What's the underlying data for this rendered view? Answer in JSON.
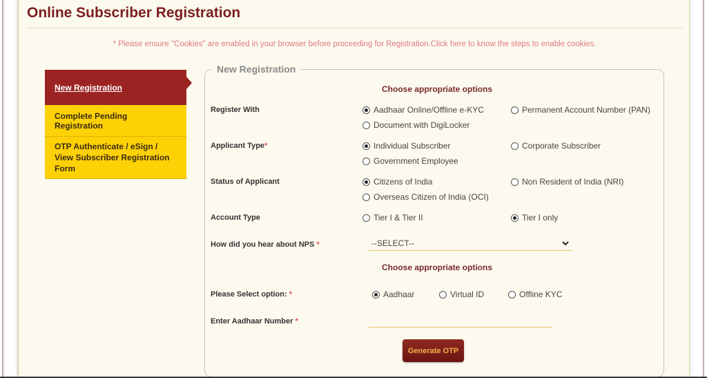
{
  "page": {
    "title": "Online Subscriber Registration",
    "cookie_notice": "* Please ensure \"Cookies\" are enabled in your browser before proceeding for Registration.",
    "cookie_link": "Click here to know the steps to enable cookies."
  },
  "sidebar": {
    "items": [
      {
        "label": "New Registration",
        "active": true
      },
      {
        "label": "Complete Pending Registration",
        "active": false
      },
      {
        "label": "OTP Authenticate / eSign / View Subscriber Registration Form",
        "active": false
      }
    ]
  },
  "form": {
    "legend": "New Registration",
    "section1_heading": "Choose appropriate options",
    "register_with": {
      "label": "Register With",
      "options": [
        {
          "label": "Aadhaar Online/Offline e-KYC",
          "checked": true
        },
        {
          "label": "Permanent Account Number (PAN)",
          "checked": false
        },
        {
          "label": "Document with DigiLocker",
          "checked": false
        }
      ]
    },
    "applicant_type": {
      "label": "Applicant Type",
      "required_mark": "*",
      "options": [
        {
          "label": "Individual Subscriber",
          "checked": true
        },
        {
          "label": "Corporate Subscriber",
          "checked": false
        },
        {
          "label": "Government Employee",
          "checked": false
        }
      ]
    },
    "status_of_applicant": {
      "label": "Status of Applicant",
      "options": [
        {
          "label": "Citizens of India",
          "checked": true
        },
        {
          "label": "Non Resident of India (NRI)",
          "checked": false
        },
        {
          "label": "Overseas Citizen of India (OCI)",
          "checked": false
        }
      ]
    },
    "account_type": {
      "label": "Account Type",
      "options": [
        {
          "label": "Tier I & Tier II",
          "checked": false
        },
        {
          "label": "Tier I only",
          "checked": true
        }
      ]
    },
    "hear_about": {
      "label": "How did you hear about NPS",
      "required_mark": "*",
      "selected": "--SELECT--"
    },
    "section2_heading": "Choose appropriate options",
    "select_option": {
      "label": "Please Select option:",
      "required_mark": "*",
      "options": [
        {
          "label": "Aadhaar",
          "checked": true
        },
        {
          "label": "Virtual ID",
          "checked": false
        },
        {
          "label": "Offline KYC",
          "checked": false
        }
      ]
    },
    "aadhaar_number": {
      "label": "Enter Aadhaar Number",
      "required_mark": "*",
      "value": ""
    },
    "generate_otp_label": "Generate OTP"
  },
  "colors": {
    "brand_maroon": "#9b2423",
    "accent_yellow": "#fcd106",
    "page_bg": "#fcf9ef",
    "notice_pink": "#e07b7b",
    "button_text": "#f2b24a"
  }
}
